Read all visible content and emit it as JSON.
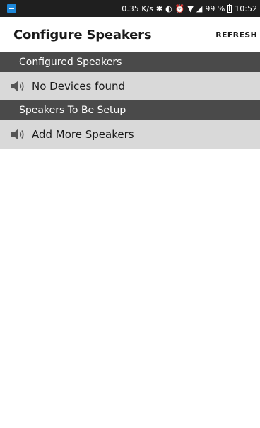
{
  "status_bar": {
    "speed": "0.35 K/s",
    "battery": "99 %",
    "time": "10:52",
    "icons": [
      "bluetooth-icon",
      "vibrate-icon",
      "alarm-icon",
      "wifi-icon",
      "signal-icon",
      "battery-icon"
    ]
  },
  "app_bar": {
    "title": "Configure Speakers",
    "refresh_label": "REFRESH"
  },
  "sections": {
    "configured": {
      "header": "Configured Speakers",
      "item_label": "No Devices found",
      "item_icon": "speaker-icon"
    },
    "to_setup": {
      "header": "Speakers To Be Setup",
      "item_label": "Add More Speakers",
      "item_icon": "speaker-icon"
    }
  },
  "colors": {
    "status_bar": "#1f1f1f",
    "section_header": "#4a4a4a",
    "list_row": "#d9d9d9",
    "app_icon": "#1e88d9"
  }
}
